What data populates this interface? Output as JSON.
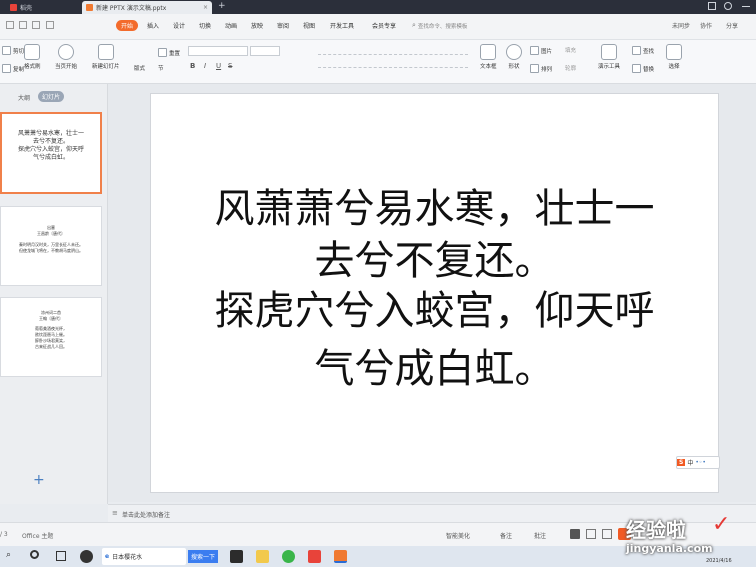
{
  "tabs": [
    {
      "label": "稻壳",
      "color": "#e8433a"
    },
    {
      "label": "新建 PPTX 演示文稿.pptx",
      "color": "#f07a32"
    }
  ],
  "menu": {
    "items": [
      "开始",
      "插入",
      "设计",
      "切换",
      "动画",
      "放映",
      "审阅",
      "视图",
      "开发工具",
      "会员专享"
    ],
    "active": "开始",
    "search_placeholder": "查找命令、搜索模板",
    "right": [
      "未同步",
      "协作",
      "分享"
    ]
  },
  "ribbon": {
    "cut": "剪切",
    "copy": "复制",
    "format_painter": "格式刷",
    "from_current": "当页开始",
    "new_slide": "新建幻灯片",
    "layout": "版式",
    "section": "节",
    "reset": "重置",
    "textbox": "文本框",
    "shape": "形状",
    "arrange": "排列",
    "picture": "图片",
    "fill": "填充",
    "outline": "轮廓",
    "presenter": "演示工具",
    "find": "查找",
    "replace": "替换",
    "select": "选择",
    "bold": "B",
    "italic": "I",
    "underline": "U",
    "strike": "S"
  },
  "left": {
    "tab_outline": "大纲",
    "tab_slides": "幻灯片",
    "thumb1": [
      "风萧萧兮易水寒，壮士一",
      "去兮不复还。",
      "探虎穴兮入蛟宫，仰天呼",
      "气兮成白虹。"
    ],
    "thumb2": [
      "出塞",
      "王昌龄〔唐代〕",
      "秦时明月汉时关，万里长征人未还。",
      "但使龙城飞将在，不教胡马度阴山。"
    ],
    "thumb3": [
      "凉州词二首",
      "王翰〔唐代〕",
      "葡萄美酒夜光杯，",
      "欲饮琵琶马上催。",
      "醉卧沙场君莫笑，",
      "古来征战几人回。"
    ],
    "add_icon": "+"
  },
  "slide": {
    "lines": [
      "风萧萧兮易水寒，壮士一",
      "去兮不复还。",
      "探虎穴兮入蛟宫，仰天呼",
      "气兮成白虹。"
    ]
  },
  "notes": {
    "placeholder": "单击此处添加备注"
  },
  "status": {
    "page": "/ 3",
    "theme": "Office 主题",
    "beautify": "智能美化",
    "notes": "备注",
    "comment": "批注"
  },
  "taskbar": {
    "search_text": "日本樱花水",
    "baidu": "搜索一下",
    "date": "2021/4/16"
  },
  "ime": {
    "label": "中"
  },
  "watermark": {
    "text": "经验啦",
    "url": "jingyanla.com"
  }
}
